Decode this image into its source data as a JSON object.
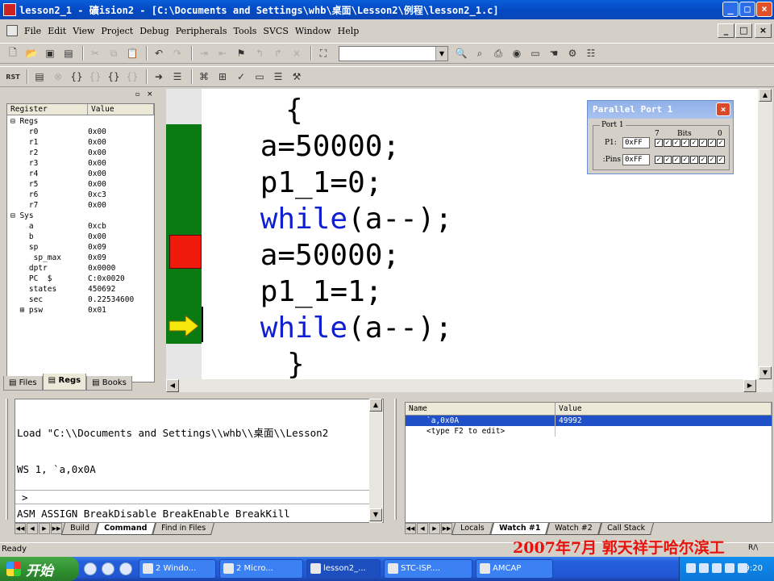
{
  "window": {
    "title": "lesson2_1  - 礦ision2 - [C:\\Documents and Settings\\whb\\桌面\\Lesson2\\例程\\lesson2_1.c]",
    "caption_buttons": [
      "_",
      "□",
      "×"
    ],
    "mdi_buttons": [
      "_",
      "□",
      "×"
    ]
  },
  "menu": [
    "File",
    "Edit",
    "View",
    "Project",
    "Debug",
    "Peripherals",
    "Tools",
    "SVCS",
    "Window",
    "Help"
  ],
  "toolbar1": {
    "find_value": "",
    "icons": [
      "new-file-icon",
      "open-folder-icon",
      "save-icon",
      "save-all-icon",
      "cut-icon",
      "copy-icon",
      "paste-icon",
      "undo-icon",
      "redo-icon",
      "indent-icon",
      "unindent-icon",
      "bookmark-icon",
      "prev-bookmark-icon",
      "next-bookmark-icon",
      "clear-bookmarks-icon",
      "find-in-files-icon",
      "find-icon",
      "incremental-find-icon",
      "print-icon",
      "debug-session-icon",
      "window-icon",
      "hand-icon",
      "options-icon",
      "project-window-icon"
    ]
  },
  "toolbar2": {
    "rst_label": "RST",
    "icons": [
      "reset-icon",
      "run-icon",
      "stop-icon",
      "step-into-icon",
      "step-over-icon",
      "step-out-icon",
      "run-to-cursor-icon",
      "show-next-statement-icon",
      "disassembly-icon",
      "watch-window-icon",
      "code-coverage-icon",
      "performance-icon",
      "serial-window-icon",
      "memory-window-icon",
      "toolbox-icon"
    ]
  },
  "registers": {
    "headers": [
      "Register",
      "Value"
    ],
    "rows": [
      {
        "name": "⊟ Regs",
        "value": ""
      },
      {
        "name": "    r0",
        "value": "0x00"
      },
      {
        "name": "    r1",
        "value": "0x00"
      },
      {
        "name": "    r2",
        "value": "0x00"
      },
      {
        "name": "    r3",
        "value": "0x00"
      },
      {
        "name": "    r4",
        "value": "0x00"
      },
      {
        "name": "    r5",
        "value": "0x00"
      },
      {
        "name": "    r6",
        "value": "0xc3"
      },
      {
        "name": "    r7",
        "value": "0x00"
      },
      {
        "name": "⊟ Sys",
        "value": ""
      },
      {
        "name": "    a",
        "value": "0xcb"
      },
      {
        "name": "    b",
        "value": "0x00"
      },
      {
        "name": "    sp",
        "value": "0x09"
      },
      {
        "name": "     sp_max",
        "value": "0x09"
      },
      {
        "name": "    dptr",
        "value": "0x0000"
      },
      {
        "name": "    PC  $",
        "value": "C:0x0020"
      },
      {
        "name": "    states",
        "value": "450692"
      },
      {
        "name": "    sec",
        "value": "0.22534600"
      },
      {
        "name": "  ⊞ psw",
        "value": "0x01"
      }
    ],
    "tabs": [
      "Files",
      "Regs",
      "Books"
    ],
    "active_tab": "Regs"
  },
  "code": {
    "lines": [
      {
        "text": "{",
        "kw": "",
        "rest": ""
      },
      {
        "text": "    a=50000;",
        "kw": "",
        "rest": ""
      },
      {
        "text": "    p1_1=0;",
        "kw": "",
        "rest": ""
      },
      {
        "text": "    ",
        "kw": "while",
        "rest": "(a--);"
      },
      {
        "text": "    a=50000;",
        "kw": "",
        "rest": ""
      },
      {
        "text": "    p1_1=1;",
        "kw": "",
        "rest": ""
      },
      {
        "text": "    ",
        "kw": "while",
        "rest": "(a--);"
      },
      {
        "text": "}",
        "kw": "",
        "rest": ""
      }
    ]
  },
  "parallel_port": {
    "title": "Parallel Port 1",
    "group_label": "Port 1",
    "p1_label": "P1:",
    "p1_value": "0xFF",
    "pins_label": "Pins:",
    "pins_value": "0xFF",
    "bits_hi": "7",
    "bits_label": "Bits",
    "bits_lo": "0",
    "p1_bits": [
      true,
      true,
      true,
      true,
      true,
      true,
      true,
      true
    ],
    "pins_bits": [
      true,
      true,
      true,
      true,
      true,
      true,
      true,
      true
    ]
  },
  "command": {
    "output_line1": "Load \"C:\\\\Documents and Settings\\\\whb\\\\桌面\\\\Lesson2",
    "output_line2": "WS 1, `a,0x0A",
    "prompt": ">",
    "help": "ASM ASSIGN BreakDisable BreakEnable BreakKill",
    "tabs": [
      "Build",
      "Command",
      "Find in Files"
    ],
    "active_tab": "Command"
  },
  "watch": {
    "headers": [
      "Name",
      "Value"
    ],
    "rows": [
      {
        "name": "`a,0x0A",
        "value": "49992",
        "selected": true
      },
      {
        "name": "<type F2 to edit>",
        "value": "",
        "selected": false
      }
    ],
    "tabs": [
      "Locals",
      "Watch #1",
      "Watch #2",
      "Call Stack"
    ],
    "active_tab": "Watch #1"
  },
  "status": {
    "left": "Ready",
    "right": "R/\\"
  },
  "watermark": "2007年7月  郭天祥于哈尔滨工",
  "taskbar": {
    "start": "开始",
    "tasks": [
      "2 Windo...",
      "2 Micro...",
      "lesson2_...",
      "STC-ISP....",
      "AMCAP"
    ],
    "active_task": "lesson2_...",
    "clock": "9:20"
  },
  "colors": {
    "accent": "#0349c4",
    "keyword": "#1020d0",
    "gutter_green": "#0a7a12",
    "breakpoint_red": "#f01a0a",
    "pc_arrow_yellow": "#f5e80a",
    "watermark_red": "#e8120c"
  }
}
